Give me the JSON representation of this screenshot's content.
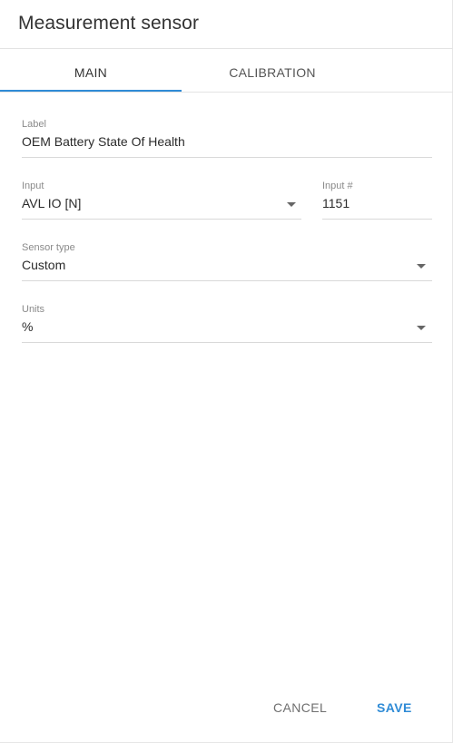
{
  "dialog": {
    "title": "Measurement sensor"
  },
  "tabs": [
    {
      "label": "MAIN",
      "active": true
    },
    {
      "label": "CALIBRATION",
      "active": false
    }
  ],
  "form": {
    "label": {
      "label": "Label",
      "value": "OEM Battery State Of Health"
    },
    "input": {
      "label": "Input",
      "value": "AVL IO [N]"
    },
    "input_number": {
      "label": "Input #",
      "value": "1151"
    },
    "sensor_type": {
      "label": "Sensor type",
      "value": "Custom"
    },
    "units": {
      "label": "Units",
      "value": "%"
    }
  },
  "footer": {
    "cancel_label": "CANCEL",
    "save_label": "SAVE"
  },
  "colors": {
    "accent": "#2f8bd6",
    "divider": "#e3e3e3",
    "text": "#2b2b2b",
    "muted": "#8a8a8a"
  },
  "icons": {
    "dropdown": "chevron-down-icon"
  }
}
